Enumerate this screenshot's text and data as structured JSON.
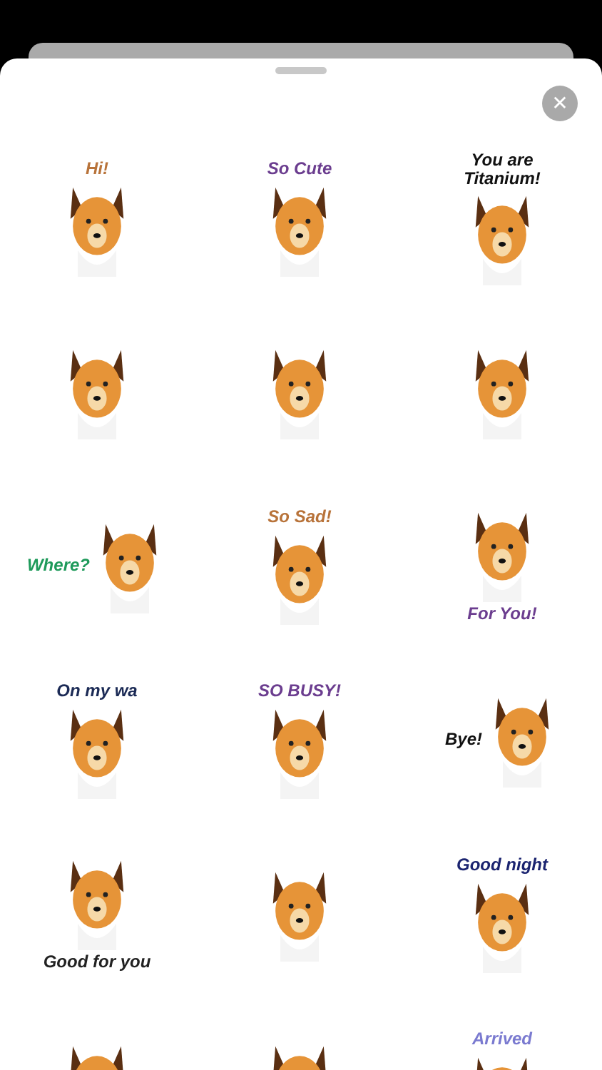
{
  "sheet": {
    "close_label": "✕"
  },
  "stickers": [
    {
      "caption": "Hi!",
      "color": "#b8733a",
      "kind": "top"
    },
    {
      "caption": "So Cute",
      "color": "#6b3d8f",
      "kind": "top"
    },
    {
      "caption": "You are Titanium!",
      "color": "#111111",
      "kind": "top"
    },
    {
      "kind": "plain"
    },
    {
      "kind": "plain"
    },
    {
      "kind": "plain"
    },
    {
      "caption": "Where?",
      "color": "#1e9a5a",
      "kind": "side"
    },
    {
      "caption": "So Sad!",
      "color": "#b8733a",
      "kind": "top"
    },
    {
      "caption": "For You!",
      "color": "#6b3d8f",
      "kind": "bottom"
    },
    {
      "caption": "On my wa",
      "color": "#1b2a55",
      "kind": "top"
    },
    {
      "caption": "SO BUSY!",
      "color": "#6b3d8f",
      "kind": "top"
    },
    {
      "caption": "Bye!",
      "color": "#111111",
      "kind": "side"
    },
    {
      "caption": "Good for you",
      "color": "#222222",
      "kind": "bottom"
    },
    {
      "kind": "plain"
    },
    {
      "caption": "Good night",
      "color": "#1b2470",
      "kind": "top"
    },
    {
      "kind": "plain"
    },
    {
      "kind": "plain"
    },
    {
      "caption": "Arrived",
      "color": "#7a7ad0",
      "kind": "top"
    }
  ]
}
